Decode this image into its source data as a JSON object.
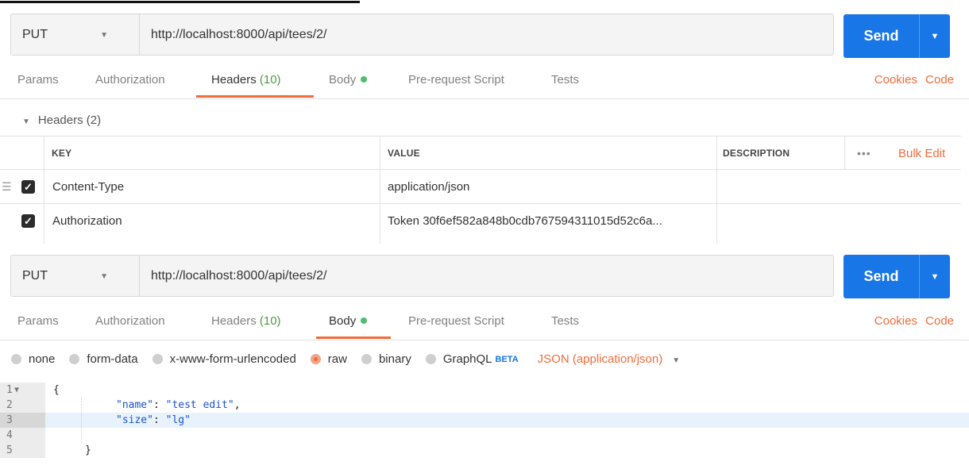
{
  "request1": {
    "method": "PUT",
    "url": "http://localhost:8000/api/tees/2/",
    "send_label": "Send",
    "tabs": [
      {
        "label": "Params"
      },
      {
        "label": "Authorization"
      },
      {
        "label": "Headers",
        "count": "(10)"
      },
      {
        "label": "Body"
      },
      {
        "label": "Pre-request Script"
      },
      {
        "label": "Tests"
      }
    ],
    "active_tab": "Headers",
    "links": {
      "cookies": "Cookies",
      "code": "Code"
    },
    "headers_section": "Headers (2)",
    "columns": {
      "key": "KEY",
      "value": "VALUE",
      "description": "DESCRIPTION",
      "more": "•••",
      "bulk_edit": "Bulk Edit"
    },
    "rows": [
      {
        "key": "Content-Type",
        "value": "application/json",
        "checked": true
      },
      {
        "key": "Authorization",
        "value": "Token 30f6ef582a848b0cdb767594311015d52c6a...",
        "checked": true
      }
    ]
  },
  "request2": {
    "method": "PUT",
    "url": "http://localhost:8000/api/tees/2/",
    "send_label": "Send",
    "tabs": [
      {
        "label": "Params"
      },
      {
        "label": "Authorization"
      },
      {
        "label": "Headers",
        "count": "(10)"
      },
      {
        "label": "Body"
      },
      {
        "label": "Pre-request Script"
      },
      {
        "label": "Tests"
      }
    ],
    "active_tab": "Body",
    "links": {
      "cookies": "Cookies",
      "code": "Code"
    },
    "body_types": [
      "none",
      "form-data",
      "x-www-form-urlencoded",
      "raw",
      "binary",
      "GraphQL"
    ],
    "selected_body_type": "raw",
    "beta_label": "BETA",
    "content_type": "JSON (application/json)",
    "code_lines": [
      {
        "n": "1",
        "text": "{"
      },
      {
        "n": "2",
        "key": "\"name\"",
        "value": "\"test edit\"",
        "tail": ","
      },
      {
        "n": "3",
        "key": "\"size\"",
        "value": "\"lg\"",
        "tail": ""
      },
      {
        "n": "4",
        "text": ""
      },
      {
        "n": "5",
        "text": "}"
      }
    ],
    "highlighted_line": "3"
  },
  "colors": {
    "accent": "#f26b3a",
    "send": "#1976e6",
    "active_dot": "#4cbe6e"
  }
}
